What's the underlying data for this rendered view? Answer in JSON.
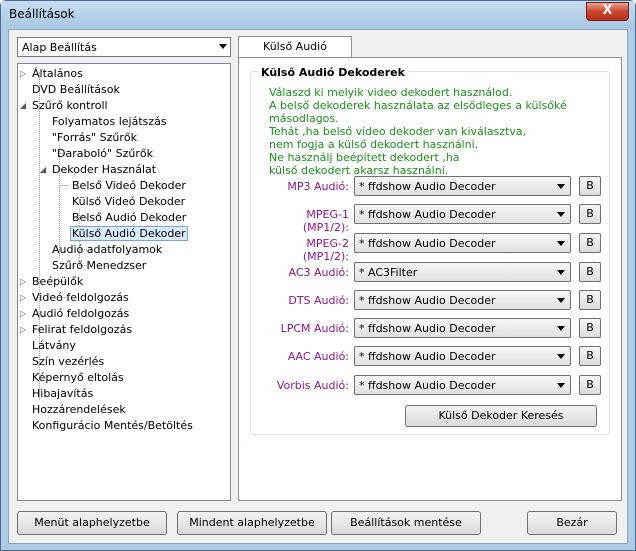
{
  "window": {
    "title": "Beállítások",
    "close_glyph": "X"
  },
  "preset": {
    "selected": "Alap Beállítás"
  },
  "tree": {
    "items": [
      "Általános",
      "DVD Beállítások",
      "Szűrő kontroll",
      "Folyamatos lejátszás",
      "\"Forrás\" Szűrők",
      "\"Daraboló\" Szűrők",
      "Dekoder Használat",
      "Belső Videó Dekoder",
      "Külső Videó Dekoder",
      "Belső Audió Dekoder",
      "Külső Audió Dekoder",
      "Audió adatfolyamok",
      "Szűrő Menedzser",
      "Beépülők",
      "Videó feldolgozás",
      "Audió feldolgozás",
      "Felirat feldolgozás",
      "Látvány",
      "Szín vezérlés",
      "Képernyő eltolás",
      "Hibajavítás",
      "Hozzárendelések",
      "Konfigurácio Mentés/Betöltés"
    ],
    "selected": "Külső Audió Dekoder"
  },
  "tab": {
    "label": "Külső Audió Dekoder"
  },
  "group": {
    "title": "Külső Audió Dekoderek",
    "info_lines": [
      "Válaszd ki melyik video dekodert használod.",
      "A belső dekoderek használata az elsődleges a külsőké másodlagos.",
      "Tehát ,ha belső video dekoder van kiválasztva,",
      "nem fogja a külső dekodert használni.",
      "Ne használj beépített dekodert ,ha",
      "külső dekodert akarsz használni."
    ]
  },
  "decoders": [
    {
      "label": "MP3 Audió:",
      "value": "* ffdshow Audio Decoder",
      "button": "B"
    },
    {
      "label": "MPEG-1 (MP1/2):",
      "value": "* ffdshow Audio Decoder",
      "button": "B"
    },
    {
      "label": "MPEG-2 (MP1/2):",
      "value": "* ffdshow Audio Decoder",
      "button": "B"
    },
    {
      "label": "AC3 Audió:",
      "value": "* AC3Filter",
      "button": "B"
    },
    {
      "label": "DTS Audió:",
      "value": "* ffdshow Audio Decoder",
      "button": "B"
    },
    {
      "label": "LPCM Audió:",
      "value": "* ffdshow Audio Decoder",
      "button": "B"
    },
    {
      "label": "AAC Audió:",
      "value": "* ffdshow Audio Decoder",
      "button": "B"
    },
    {
      "label": "Vorbis Audió:",
      "value": "* ffdshow Audio Decoder",
      "button": "B"
    }
  ],
  "search_button": "Külső Dekoder Keresés",
  "footer": {
    "reset_menu": "Menüt alaphelyzetbe",
    "reset_all": "Mindent alaphelyzetbe",
    "save": "Beállítások mentése",
    "close": "Bezár"
  },
  "colors": {
    "info_text": "#1f8c1f",
    "decoder_label": "#8b168b",
    "title_bar": "#aecbe6"
  }
}
